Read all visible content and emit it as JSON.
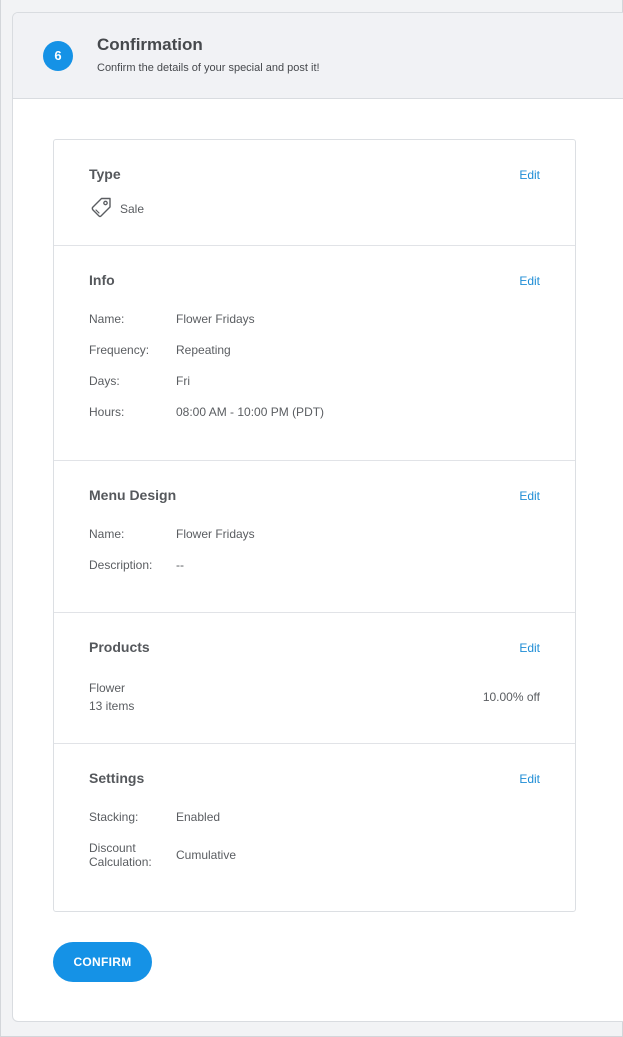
{
  "header": {
    "step_number": "6",
    "title": "Confirmation",
    "subtitle": "Confirm the details of your special and post it!"
  },
  "sections": {
    "type": {
      "title": "Type",
      "edit_label": "Edit",
      "icon": "price-tag-icon",
      "value": "Sale"
    },
    "info": {
      "title": "Info",
      "edit_label": "Edit",
      "rows": [
        {
          "label": "Name:",
          "value": "Flower Fridays"
        },
        {
          "label": "Frequency:",
          "value": "Repeating"
        },
        {
          "label": "Days:",
          "value": "Fri"
        },
        {
          "label": "Hours:",
          "value": "08:00 AM - 10:00 PM (PDT)"
        }
      ]
    },
    "menu_design": {
      "title": "Menu Design",
      "edit_label": "Edit",
      "rows": [
        {
          "label": "Name:",
          "value": "Flower Fridays"
        },
        {
          "label": "Description:",
          "value": "--"
        }
      ]
    },
    "products": {
      "title": "Products",
      "edit_label": "Edit",
      "category": "Flower",
      "item_count": "13 items",
      "discount": "10.00% off"
    },
    "settings": {
      "title": "Settings",
      "edit_label": "Edit",
      "rows": [
        {
          "label": "Stacking:",
          "value": "Enabled"
        },
        {
          "label": "Discount Calculation:",
          "value": "Cumulative"
        }
      ]
    }
  },
  "actions": {
    "confirm_label": "CONFIRM"
  },
  "colors": {
    "accent": "#1592e6",
    "link": "#1f8dd6",
    "header_bg": "#f1f2f5"
  }
}
